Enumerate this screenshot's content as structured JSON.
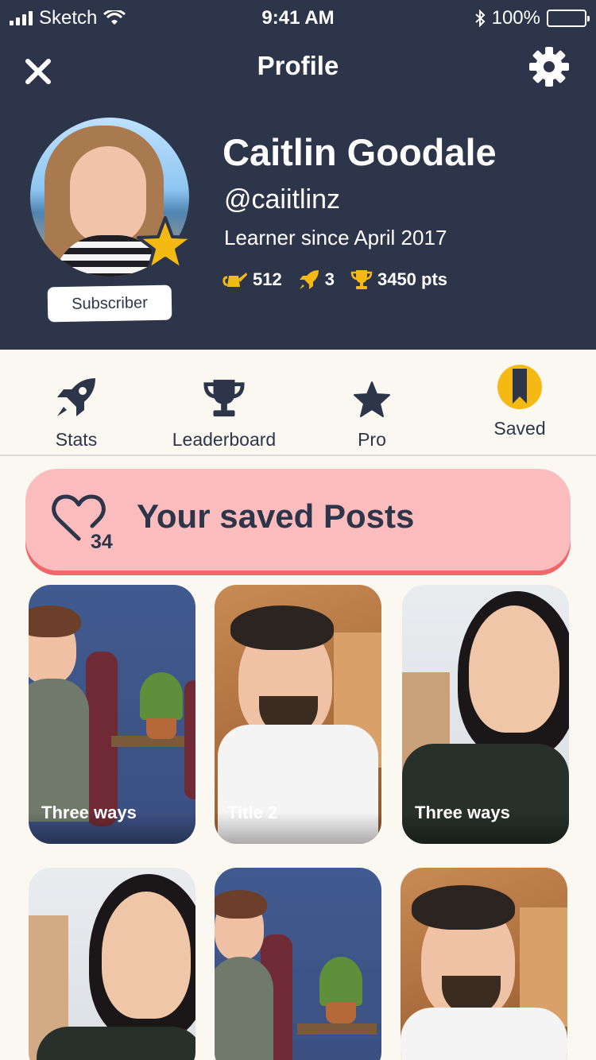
{
  "status_bar": {
    "carrier": "Sketch",
    "time": "9:41 AM",
    "battery": "100%"
  },
  "header": {
    "title": "Profile"
  },
  "profile": {
    "name": "Caitlin Goodale",
    "handle": "@caiitlinz",
    "since": "Learner since April 2017",
    "badge": "Subscriber",
    "stats": {
      "watering": "512",
      "rockets": "3",
      "points": "3450 pts"
    }
  },
  "tabs": [
    {
      "label": "Stats",
      "icon": "rocket-icon"
    },
    {
      "label": "Leaderboard",
      "icon": "trophy-icon"
    },
    {
      "label": "Pro",
      "icon": "star-icon"
    },
    {
      "label": "Saved",
      "icon": "bookmark-icon",
      "active": true
    }
  ],
  "saved": {
    "title": "Your saved Posts",
    "count": "34"
  },
  "posts": [
    {
      "caption": "Three ways"
    },
    {
      "caption": "Title 2"
    },
    {
      "caption": "Three ways"
    },
    {
      "caption": ""
    },
    {
      "caption": ""
    },
    {
      "caption": ""
    }
  ],
  "colors": {
    "navy": "#2c3549",
    "gold": "#f5b914",
    "pink": "#fbbcbd",
    "pink_shadow": "#f16669",
    "cream": "#fbf8f1"
  }
}
